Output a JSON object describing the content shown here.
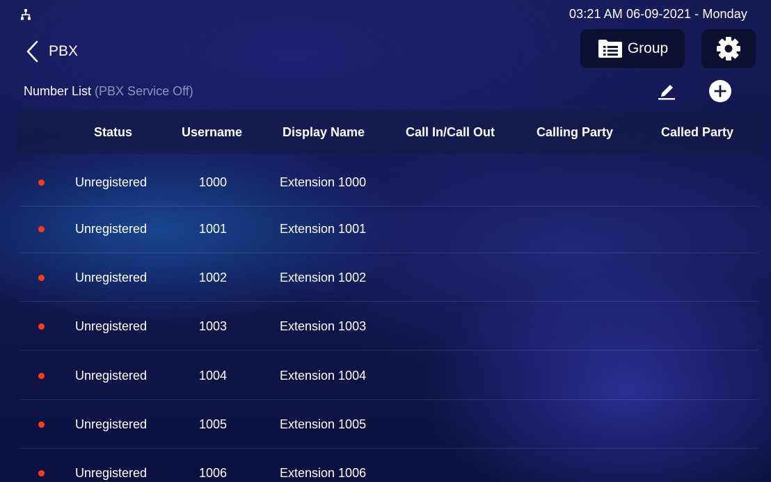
{
  "status_bar": {
    "network_icon": "network-tree-icon",
    "datetime": "03:21 AM  06-09-2021 - Monday"
  },
  "header": {
    "back_icon": "chevron-left-icon",
    "title": "PBX",
    "group_button": {
      "icon": "list-folder-icon",
      "label": "Group"
    },
    "settings_icon": "gear-icon"
  },
  "number_list": {
    "label": "Number List",
    "note": "(PBX Service Off)",
    "edit_icon": "pencil-icon",
    "add_icon": "plus-circle-icon"
  },
  "table": {
    "columns": [
      "Status",
      "Username",
      "Display Name",
      "Call In/Call Out",
      "Calling Party",
      "Called Party"
    ],
    "rows": [
      {
        "status": "Unregistered",
        "username": "1000",
        "display_name": "Extension 1000",
        "call_in_out": "",
        "calling_party": "",
        "called_party": ""
      },
      {
        "status": "Unregistered",
        "username": "1001",
        "display_name": "Extension 1001",
        "call_in_out": "",
        "calling_party": "",
        "called_party": ""
      },
      {
        "status": "Unregistered",
        "username": "1002",
        "display_name": "Extension 1002",
        "call_in_out": "",
        "calling_party": "",
        "called_party": ""
      },
      {
        "status": "Unregistered",
        "username": "1003",
        "display_name": "Extension 1003",
        "call_in_out": "",
        "calling_party": "",
        "called_party": ""
      },
      {
        "status": "Unregistered",
        "username": "1004",
        "display_name": "Extension 1004",
        "call_in_out": "",
        "calling_party": "",
        "called_party": ""
      },
      {
        "status": "Unregistered",
        "username": "1005",
        "display_name": "Extension 1005",
        "call_in_out": "",
        "calling_party": "",
        "called_party": ""
      },
      {
        "status": "Unregistered",
        "username": "1006",
        "display_name": "Extension 1006",
        "call_in_out": "",
        "calling_party": "",
        "called_party": ""
      }
    ]
  },
  "colors": {
    "unregistered_dot": "#ff3b1f",
    "background": "#121650"
  }
}
